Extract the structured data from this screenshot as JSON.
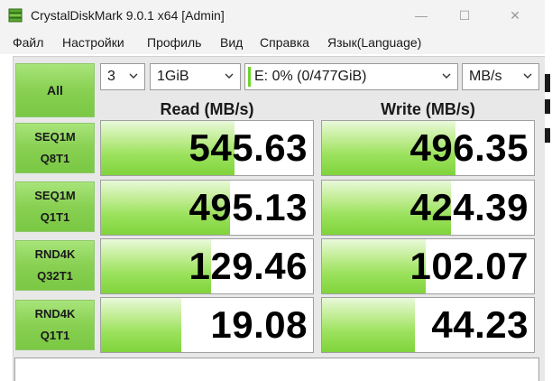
{
  "window": {
    "title": "CrystalDiskMark 9.0.1 x64 [Admin]"
  },
  "title_buttons": {
    "minimize": "—",
    "maximize": "☐",
    "close": "✕"
  },
  "menu": [
    "Файл",
    "Настройки",
    "Профиль",
    "Вид",
    "Справка",
    "Язык(Language)"
  ],
  "controls": {
    "all_label": "All",
    "count": "3",
    "size": "1GiB",
    "drive": "E: 0% (0/477GiB)",
    "unit": "MB/s"
  },
  "headers": {
    "read": "Read (MB/s)",
    "write": "Write (MB/s)"
  },
  "tests": [
    {
      "line1": "SEQ1M",
      "line2": "Q8T1",
      "read": "545.63",
      "write": "496.35",
      "read_fill": 0.63,
      "write_fill": 0.63
    },
    {
      "line1": "SEQ1M",
      "line2": "Q1T1",
      "read": "495.13",
      "write": "424.39",
      "read_fill": 0.61,
      "write_fill": 0.61
    },
    {
      "line1": "RND4K",
      "line2": "Q32T1",
      "read": "129.46",
      "write": "102.07",
      "read_fill": 0.52,
      "write_fill": 0.49
    },
    {
      "line1": "RND4K",
      "line2": "Q1T1",
      "read": "19.08",
      "write": "44.23",
      "read_fill": 0.38,
      "write_fill": 0.44
    }
  ],
  "colors": {
    "accent_green": "#88d052",
    "bar_green": "#80d43c"
  },
  "icons": {
    "app": "disk-stack-icon",
    "dropdown": "chevron-down-icon"
  }
}
